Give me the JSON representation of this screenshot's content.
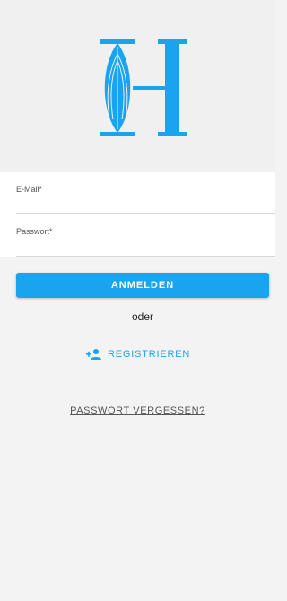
{
  "logo": {
    "icon": "h-leaf-logo-icon",
    "color": "#1aa3ef"
  },
  "form": {
    "email_label": "E-Mail*",
    "password_label": "Passwort*"
  },
  "actions": {
    "login_label": "ANMELDEN",
    "or_label": "oder",
    "register_label": "REGISTRIEREN",
    "register_icon": "add-person-icon",
    "forgot_label": "PASSWORT VERGESSEN?"
  },
  "colors": {
    "accent": "#1aa3ef",
    "background": "#f3f3f3"
  }
}
